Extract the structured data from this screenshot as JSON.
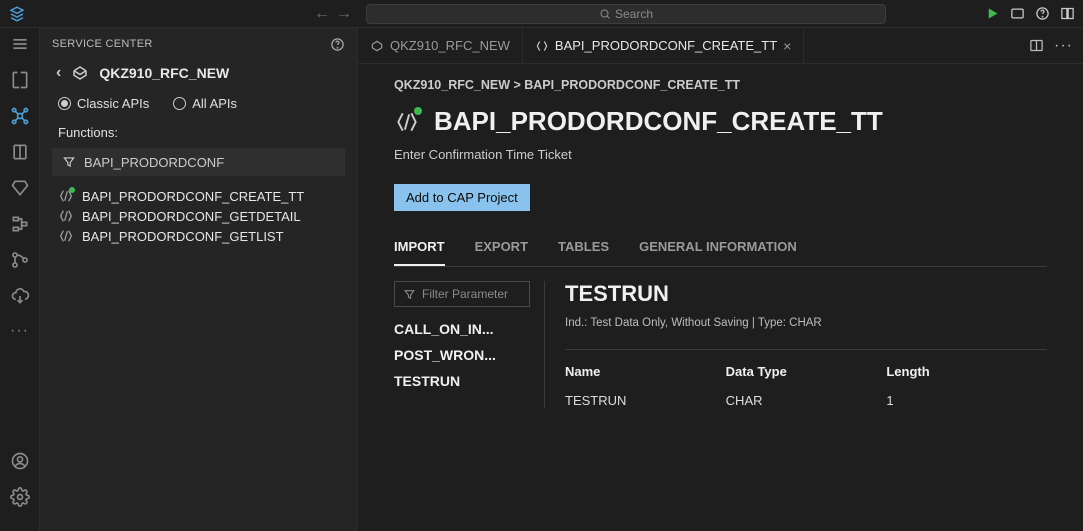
{
  "topbar": {
    "search_placeholder": "Search"
  },
  "sidepanel": {
    "title": "SERVICE CENTER",
    "project_name": "QKZ910_RFC_NEW",
    "radio_classic": "Classic APIs",
    "radio_all": "All APIs",
    "functions_label": "Functions:",
    "filter_value": "BAPI_PRODORDCONF",
    "functions": [
      "BAPI_PRODORDCONF_CREATE_TT",
      "BAPI_PRODORDCONF_GETDETAIL",
      "BAPI_PRODORDCONF_GETLIST"
    ]
  },
  "tabs": {
    "tab1": "QKZ910_RFC_NEW",
    "tab2": "BAPI_PRODORDCONF_CREATE_TT"
  },
  "main": {
    "breadcrumb": "QKZ910_RFC_NEW > BAPI_PRODORDCONF_CREATE_TT",
    "title": "BAPI_PRODORDCONF_CREATE_TT",
    "subtitle": "Enter Confirmation Time Ticket",
    "cap_button": "Add to CAP Project",
    "detail_tabs": {
      "import": "IMPORT",
      "export": "EXPORT",
      "tables": "TABLES",
      "general": "GENERAL INFORMATION"
    },
    "param_filter_placeholder": "Filter Parameter",
    "params": [
      "CALL_ON_IN...",
      "POST_WRON...",
      "TESTRUN"
    ],
    "selected_param": {
      "name": "TESTRUN",
      "desc": "Ind.: Test Data Only, Without Saving | Type: CHAR",
      "cols": {
        "name": "Name",
        "datatype": "Data Type",
        "length": "Length"
      },
      "row": {
        "name": "TESTRUN",
        "datatype": "CHAR",
        "length": "1"
      }
    }
  }
}
